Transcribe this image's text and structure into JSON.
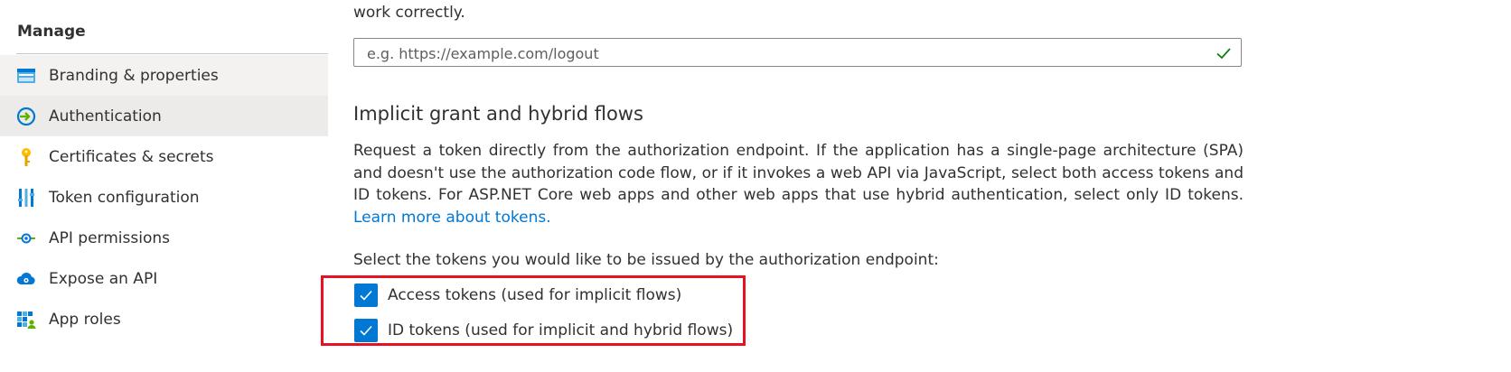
{
  "sidebar": {
    "section_title": "Manage",
    "items": [
      {
        "label": "Branding & properties",
        "icon": "branding-icon"
      },
      {
        "label": "Authentication",
        "icon": "authentication-icon"
      },
      {
        "label": "Certificates & secrets",
        "icon": "key-icon"
      },
      {
        "label": "Token configuration",
        "icon": "token-config-icon"
      },
      {
        "label": "API permissions",
        "icon": "api-permissions-icon"
      },
      {
        "label": "Expose an API",
        "icon": "cloud-icon"
      },
      {
        "label": "App roles",
        "icon": "app-roles-icon"
      }
    ]
  },
  "main": {
    "top_text": "work correctly.",
    "logout_url": {
      "placeholder": "e.g. https://example.com/logout",
      "value": ""
    },
    "implicit": {
      "title": "Implicit grant and hybrid flows",
      "description": "Request a token directly from the authorization endpoint. If the application has a single-page architecture (SPA) and doesn't use the authorization code flow, or if it invokes a web API via JavaScript, select both access tokens and ID tokens. For ASP.NET Core web apps and other web apps that use hybrid authentication, select only ID tokens.",
      "learn_more": "Learn more about tokens.",
      "select_label": "Select the tokens you would like to be issued by the authorization endpoint:",
      "access_tokens": {
        "label": "Access tokens (used for implicit flows)",
        "checked": true
      },
      "id_tokens": {
        "label": "ID tokens (used for implicit and hybrid flows)",
        "checked": true
      }
    }
  },
  "colors": {
    "accent": "#0078d4",
    "highlight": "#e81123",
    "valid": "#107c10"
  }
}
